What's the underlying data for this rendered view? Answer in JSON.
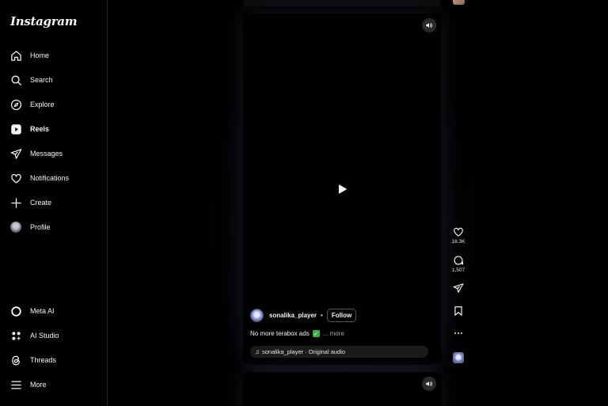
{
  "app": {
    "logo": "Instagram"
  },
  "sidebar": {
    "items": [
      {
        "label": "Home",
        "icon": "home-icon"
      },
      {
        "label": "Search",
        "icon": "search-icon"
      },
      {
        "label": "Explore",
        "icon": "compass-icon"
      },
      {
        "label": "Reels",
        "icon": "reels-icon",
        "active": true
      },
      {
        "label": "Messages",
        "icon": "send-icon"
      },
      {
        "label": "Notifications",
        "icon": "heart-icon"
      },
      {
        "label": "Create",
        "icon": "plus-icon"
      },
      {
        "label": "Profile",
        "icon": "avatar"
      }
    ],
    "bottom_items": [
      {
        "label": "Meta AI",
        "icon": "meta-ai-icon"
      },
      {
        "label": "AI Studio",
        "icon": "ai-studio-icon"
      },
      {
        "label": "Threads",
        "icon": "threads-icon"
      },
      {
        "label": "More",
        "icon": "menu-icon"
      }
    ]
  },
  "reel": {
    "author": "sonalika_player",
    "separator": "•",
    "follow_label": "Follow",
    "caption": "No more terabox ads",
    "caption_emoji": "✓",
    "more_label": "... more",
    "audio_label": "sonalika_player · Original audio"
  },
  "actions": {
    "likes": "18.3K",
    "comments": "1,507"
  },
  "colors": {
    "background": "#000000",
    "text": "#f5f5f5",
    "muted": "#a8a8a8",
    "check_green": "#3cb043"
  }
}
